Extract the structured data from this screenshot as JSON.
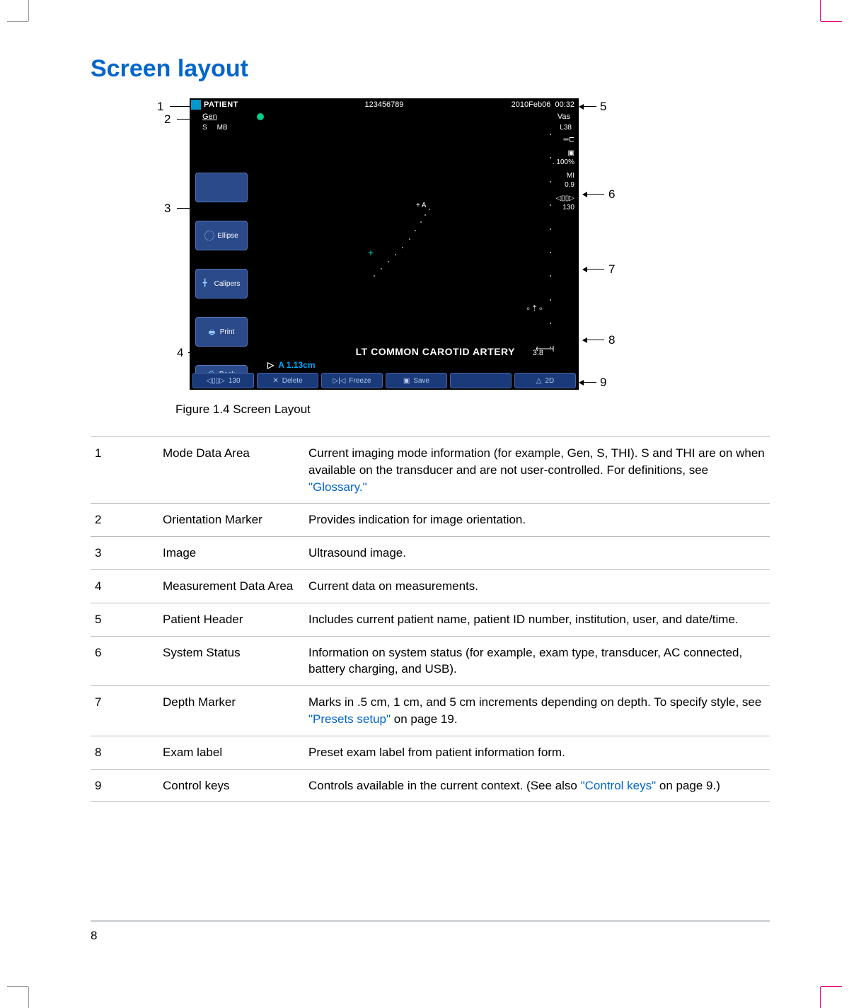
{
  "section_title": "Screen layout",
  "figure": {
    "caption": "Figure 1.4  Screen Layout",
    "callouts": [
      "1",
      "2",
      "3",
      "4",
      "5",
      "6",
      "7",
      "8",
      "9"
    ]
  },
  "screenshot": {
    "header": {
      "patient_label": "PATIENT",
      "patient_id": "123456789",
      "date": "2010Feb06",
      "time": "00:32"
    },
    "mode": {
      "gen": "Gen",
      "s": "S",
      "mb": "MB"
    },
    "right": {
      "vas": "Vas",
      "transducer": "L38",
      "pct": ". 100%",
      "mi": "MI",
      "mi_val": "0.9",
      "depth": "130"
    },
    "left_buttons": {
      "blank": "",
      "ellipse": "Ellipse",
      "calipers": "Calipers",
      "print": "Print",
      "back": "Back"
    },
    "exam_label": "LT COMMON CAROTID ARTERY",
    "depth_value": "3.8",
    "measurement": "A  1.13cm",
    "caliper_a": "A",
    "controls": {
      "c1": "130",
      "c2": "Delete",
      "c3": "Freeze",
      "c4": "Save",
      "c5": "",
      "c6": "2D"
    }
  },
  "table": [
    {
      "num": "1",
      "term": "Mode Data Area",
      "desc_a": "Current imaging mode information (for example, Gen, S, THI). S and THI are on when available on the transducer and are not user-controlled. For definitions, see ",
      "link": "\"Glossary.\"",
      "desc_b": ""
    },
    {
      "num": "2",
      "term": "Orientation Marker",
      "desc_a": "Provides indication for image orientation.",
      "link": "",
      "desc_b": ""
    },
    {
      "num": "3",
      "term": "Image",
      "desc_a": "Ultrasound image.",
      "link": "",
      "desc_b": ""
    },
    {
      "num": "4",
      "term": "Measurement Data Area",
      "desc_a": "Current data on measurements.",
      "link": "",
      "desc_b": ""
    },
    {
      "num": "5",
      "term": "Patient Header",
      "desc_a": "Includes current patient name, patient ID number, institution, user, and date/time.",
      "link": "",
      "desc_b": ""
    },
    {
      "num": "6",
      "term": "System Status",
      "desc_a": "Information on system status (for example, exam type, transducer, AC connected, battery charging, and USB).",
      "link": "",
      "desc_b": ""
    },
    {
      "num": "7",
      "term": "Depth Marker",
      "desc_a": "Marks in .5 cm, 1 cm, and 5 cm increments depending on depth. To specify style, see ",
      "link": "\"Presets setup\"",
      "desc_b": " on page 19."
    },
    {
      "num": "8",
      "term": "Exam label",
      "desc_a": "Preset exam label from patient information form.",
      "link": "",
      "desc_b": ""
    },
    {
      "num": "9",
      "term": "Control keys",
      "desc_a": "Controls available in the current context. (See also ",
      "link": "\"Control keys\"",
      "desc_b": " on page 9.)"
    }
  ],
  "page_number": "8"
}
